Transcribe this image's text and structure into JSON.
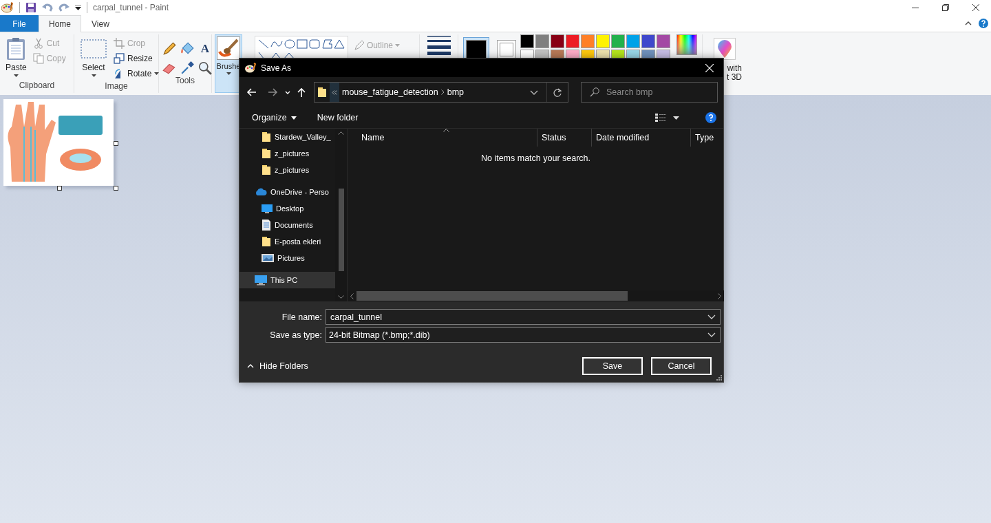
{
  "window": {
    "title": "carpal_tunnel - Paint"
  },
  "ribbon_tabs": [
    {
      "label": "File",
      "kind": "file",
      "selected": false
    },
    {
      "label": "Home",
      "kind": "tab",
      "selected": true
    },
    {
      "label": "View",
      "kind": "tab",
      "selected": false
    }
  ],
  "clipboard": {
    "label": "Clipboard",
    "paste": "Paste",
    "cut": {
      "label": "Cut",
      "disabled": true
    },
    "copy": {
      "label": "Copy",
      "disabled": true
    }
  },
  "image": {
    "label": "Image",
    "select": "Select",
    "crop": {
      "label": "Crop",
      "disabled": true
    },
    "resize": {
      "label": "Resize",
      "disabled": false
    },
    "rotate": {
      "label": "Rotate",
      "disabled": false
    }
  },
  "tools": {
    "label": "Tools",
    "text_tool": "A"
  },
  "brushes": {
    "label": "Brushe",
    "selected": true
  },
  "outline": {
    "label": "Outline",
    "disabled": true
  },
  "color_1": {
    "color": "#000000",
    "selected": true
  },
  "color_2": {
    "color": "#ffffff",
    "selected": false
  },
  "palette": [
    {
      "color": "#000000"
    },
    {
      "color": "#7f7f7f"
    },
    {
      "color": "#880015"
    },
    {
      "color": "#ed1c24"
    },
    {
      "color": "#ff7f27"
    },
    {
      "color": "#fff200"
    },
    {
      "color": "#22b14c"
    },
    {
      "color": "#00a2e8"
    },
    {
      "color": "#3f48cc"
    },
    {
      "color": "#a349a4"
    },
    {
      "color": "#ffffff"
    },
    {
      "color": "#c3c3c3"
    },
    {
      "color": "#b97a57"
    },
    {
      "color": "#ffaec9"
    },
    {
      "color": "#ffc90e"
    },
    {
      "color": "#efe4b0"
    },
    {
      "color": "#b5e61d"
    },
    {
      "color": "#99d9ea"
    },
    {
      "color": "#7092be"
    },
    {
      "color": "#c8bfe7"
    }
  ],
  "paint_3d": {
    "label_lines": [
      "with",
      "t 3D"
    ]
  },
  "dialog": {
    "title": "Save As",
    "path": [
      "mouse_fatigue_detection",
      "bmp"
    ],
    "search": {
      "placeholder": "Search bmp"
    },
    "toolbar": [
      "Organize",
      "New folder"
    ],
    "nav_continued": [
      {
        "label": "Stardew_Valley_",
        "kind": "folder",
        "selected": false
      },
      {
        "label": "z_pictures",
        "kind": "folder",
        "selected": false
      },
      {
        "label": "z_pictures",
        "kind": "folder",
        "selected": false
      }
    ],
    "nav_tree": [
      {
        "label": "OneDrive - Perso",
        "kind": "cloud",
        "selected": false,
        "children": [
          {
            "label": "Desktop",
            "kind": "desktop",
            "selected": false
          },
          {
            "label": "Documents",
            "kind": "documents",
            "selected": false
          },
          {
            "label": "E-posta ekleri",
            "kind": "folder",
            "selected": false
          },
          {
            "label": "Pictures",
            "kind": "pictures",
            "selected": false
          }
        ]
      },
      {
        "label": "This PC",
        "kind": "pc",
        "selected": true
      }
    ],
    "columns": [
      "Name",
      "Status",
      "Date modified",
      "Type"
    ],
    "empty_message": "No items match your search.",
    "file_name": {
      "label": "File name:",
      "value": "carpal_tunnel"
    },
    "save_as_type": {
      "label": "Save as type:",
      "value": "24-bit Bitmap (*.bmp;*.dib)"
    },
    "hide_folders": "Hide Folders",
    "buttons": [
      "Save",
      "Cancel"
    ]
  }
}
